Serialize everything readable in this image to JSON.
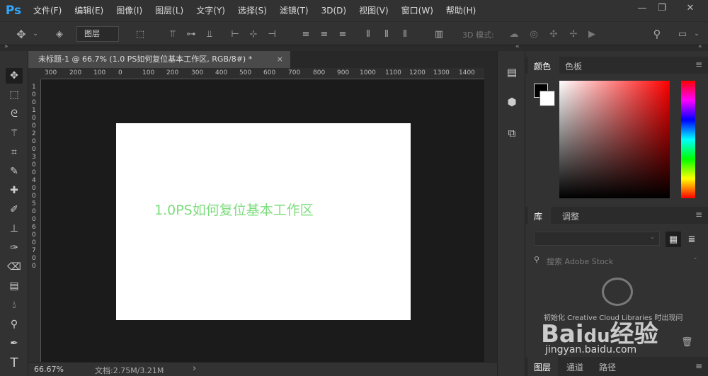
{
  "app": {
    "logo": "Ps"
  },
  "menu": [
    "文件(F)",
    "编辑(E)",
    "图像(I)",
    "图层(L)",
    "文字(Y)",
    "选择(S)",
    "滤镜(T)",
    "3D(D)",
    "视图(V)",
    "窗口(W)",
    "帮助(H)"
  ],
  "window_controls": {
    "minimize": "—",
    "restore": "❐",
    "close": "✕"
  },
  "options": {
    "layer_select": "图层",
    "mode_3d": "3D 模式:"
  },
  "collapse": {
    "left": "»",
    "right": "«"
  },
  "document": {
    "tab_title": "未标题-1 @ 66.7% (1.0 PS如何复位基本工作区, RGB/8#) *",
    "tab_close": "×",
    "canvas_text": "1.0PS如何复位基本工作区"
  },
  "ruler": {
    "h_ticks": [
      "300",
      "200",
      "100",
      "0",
      "100",
      "200",
      "300",
      "400",
      "500",
      "600",
      "700",
      "800",
      "900",
      "1000",
      "1100",
      "1200",
      "1300",
      "1400"
    ],
    "v_ticks": [
      "1",
      "0",
      "0",
      "1",
      "0",
      "0",
      "2",
      "0",
      "0",
      "3",
      "0",
      "0",
      "4",
      "0",
      "0",
      "5",
      "0",
      "0",
      "6",
      "0",
      "0",
      "7",
      "0",
      "0"
    ]
  },
  "status": {
    "zoom": "66.67%",
    "doc_info": "文档:2.75M/3.21M",
    "arrow": "›"
  },
  "panels": {
    "color": {
      "tabs": [
        "颜色",
        "色板"
      ],
      "active": 0
    },
    "library": {
      "tabs": [
        "库",
        "调整"
      ],
      "active": 0,
      "search_placeholder": "搜索 Adobe Stock",
      "message": "初始化 Creative Cloud Libraries 时出现问"
    },
    "layers": {
      "tabs": [
        "图层",
        "通道",
        "路径"
      ],
      "active": 0
    }
  },
  "watermark": {
    "text": "Bai",
    "icon_char": "du",
    "suffix": "经验",
    "url": "jingyan.baidu.com"
  },
  "colors": {
    "accent": "#31a8ff",
    "canvas_text": "#7ddc7d",
    "bg": "#323232",
    "workspace": "#1b1b1b"
  }
}
